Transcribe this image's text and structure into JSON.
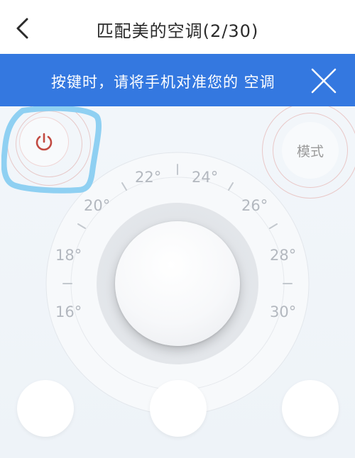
{
  "header": {
    "title": "匹配美的空调(2/30)",
    "back_icon": "chevron-left-icon"
  },
  "banner": {
    "text": "按键时，请将手机对准您的 空调",
    "close_icon": "close-icon",
    "background": "#3478e0"
  },
  "remote": {
    "power_icon": "power-icon",
    "power_color": "#c24a42",
    "mode_label": "模式",
    "temperatures": [
      "16°",
      "18°",
      "20°",
      "22°",
      "24°",
      "26°",
      "28°",
      "30°"
    ],
    "highlight_color": "#8fd0f2"
  }
}
